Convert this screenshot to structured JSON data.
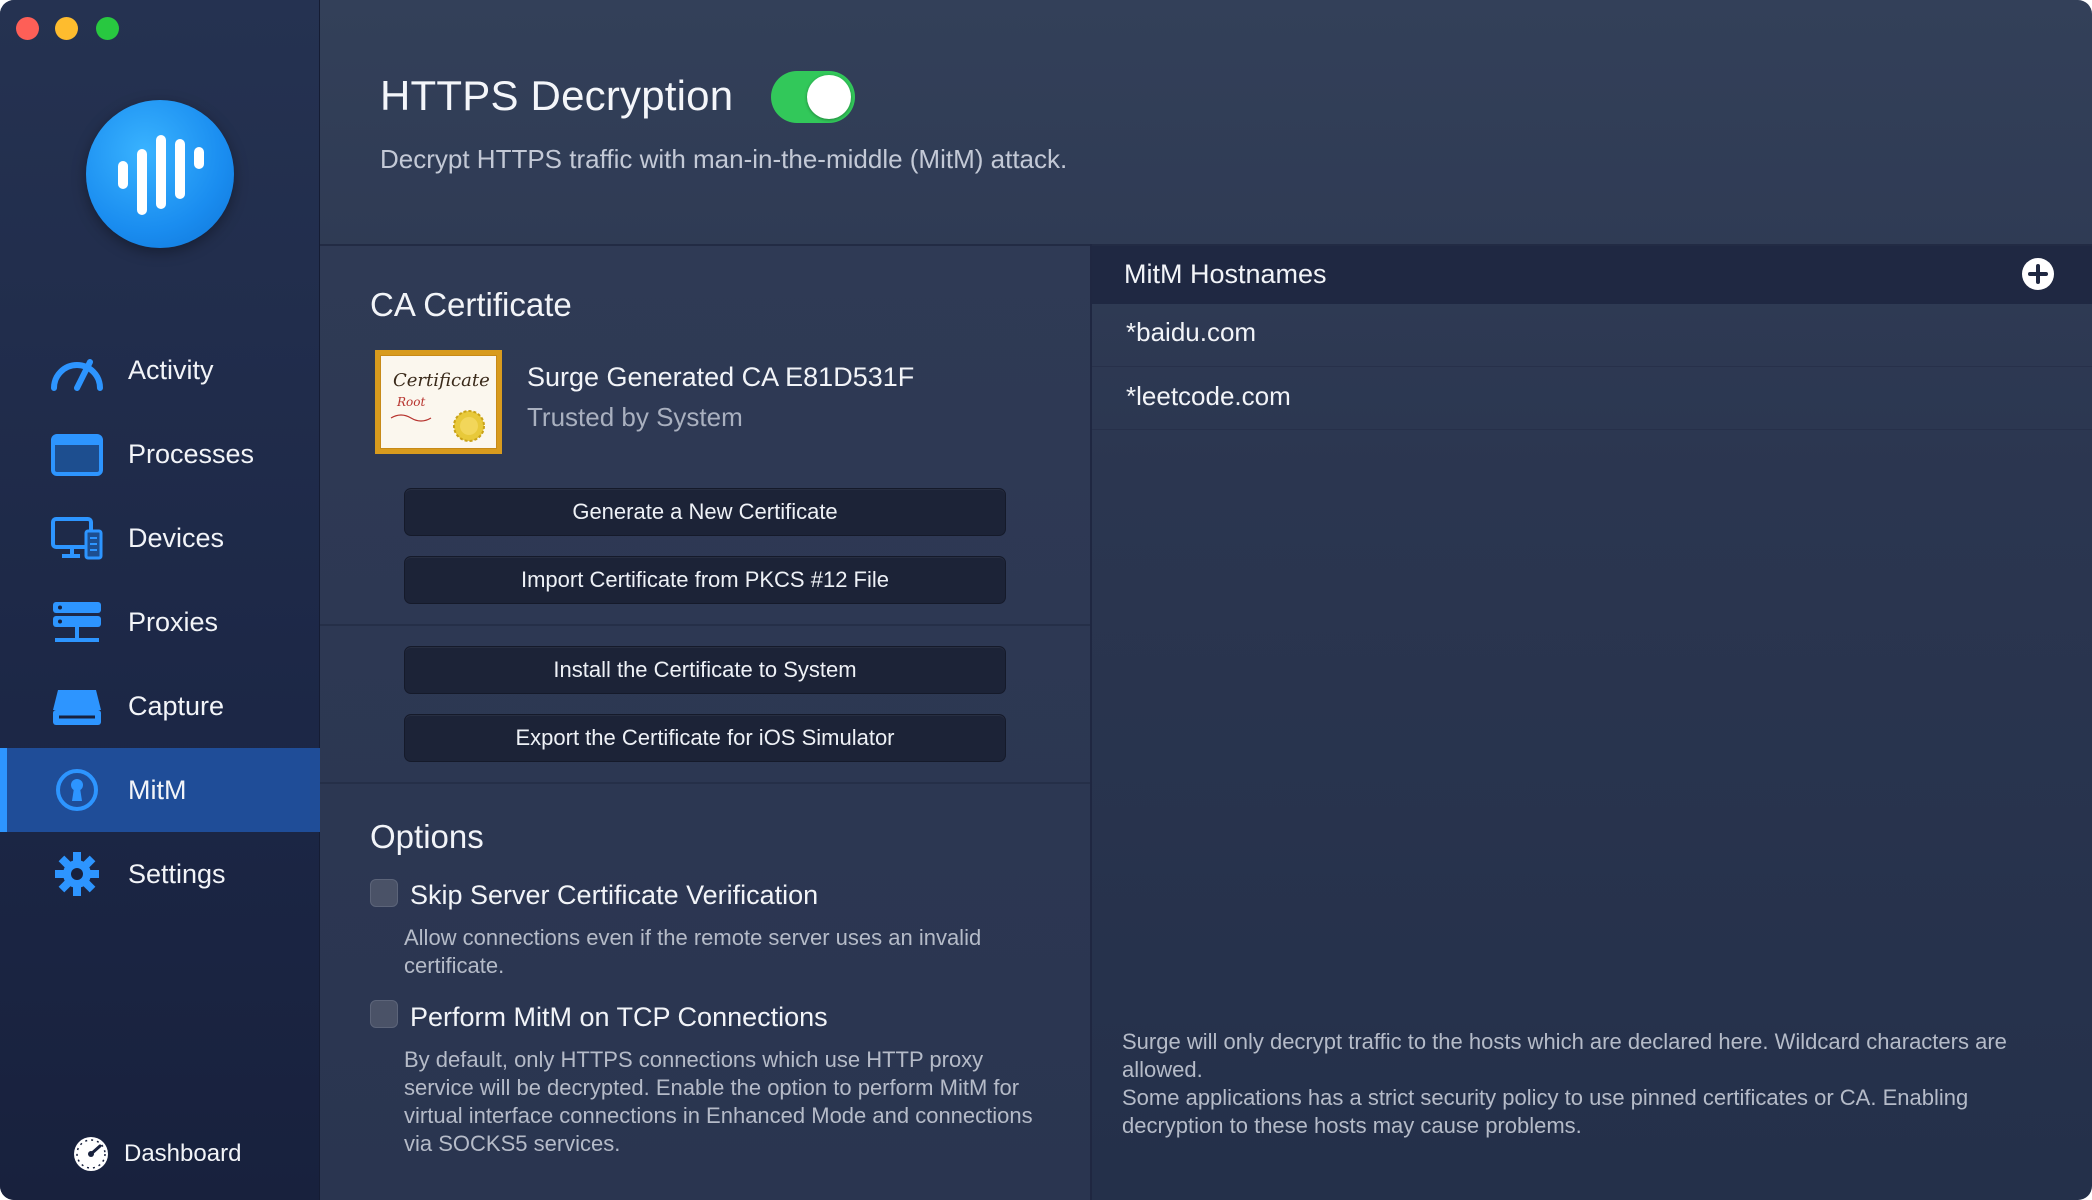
{
  "window": {
    "controls": [
      "close",
      "minimize",
      "zoom"
    ]
  },
  "sidebar": {
    "logo_icon": "surge-waveform-icon",
    "items": [
      {
        "label": "Activity",
        "icon": "speedometer-icon",
        "active": false
      },
      {
        "label": "Processes",
        "icon": "window-icon",
        "active": false
      },
      {
        "label": "Devices",
        "icon": "devices-icon",
        "active": false
      },
      {
        "label": "Proxies",
        "icon": "server-icon",
        "active": false
      },
      {
        "label": "Capture",
        "icon": "drive-icon",
        "active": false
      },
      {
        "label": "MitM",
        "icon": "keyhole-icon",
        "active": true
      },
      {
        "label": "Settings",
        "icon": "gear-icon",
        "active": false
      }
    ],
    "dashboard_label": "Dashboard",
    "dashboard_icon": "gauge-icon"
  },
  "header": {
    "title": "HTTPS Decryption",
    "enabled": true,
    "subtitle": "Decrypt HTTPS traffic with man-in-the-middle (MitM) attack."
  },
  "ca_certificate": {
    "section_title": "CA Certificate",
    "thumbnail_text": {
      "title": "Certificate",
      "subtitle": "Root"
    },
    "name": "Surge Generated CA E81D531F",
    "status": "Trusted by System",
    "buttons": {
      "generate": "Generate a New Certificate",
      "import": "Import Certificate from PKCS #12 File",
      "install": "Install the Certificate to System",
      "export": "Export the Certificate for iOS Simulator"
    }
  },
  "options": {
    "section_title": "Options",
    "skip_verification": {
      "label": "Skip Server Certificate Verification",
      "checked": false,
      "description": "Allow connections even if the remote server uses an invalid certificate."
    },
    "mitm_tcp": {
      "label": "Perform MitM on TCP Connections",
      "checked": false,
      "description": "By default, only HTTPS connections which use HTTP proxy service will be decrypted. Enable the option to perform MitM for virtual interface connections in Enhanced Mode and connections via SOCKS5 services."
    }
  },
  "hostnames": {
    "header": "MitM Hostnames",
    "add_icon": "plus-circle-icon",
    "items": [
      "*baidu.com",
      "*leetcode.com"
    ],
    "note": "Surge will only decrypt traffic to the hosts which are declared here. Wildcard characters are allowed.\nSome applications has a strict security policy to use pinned certificates or CA. Enabling decryption to these hosts may cause problems."
  },
  "colors": {
    "accent": "#2d95ff",
    "toggle_on": "#32c85a",
    "sidebar_active": "#1f4d98"
  }
}
